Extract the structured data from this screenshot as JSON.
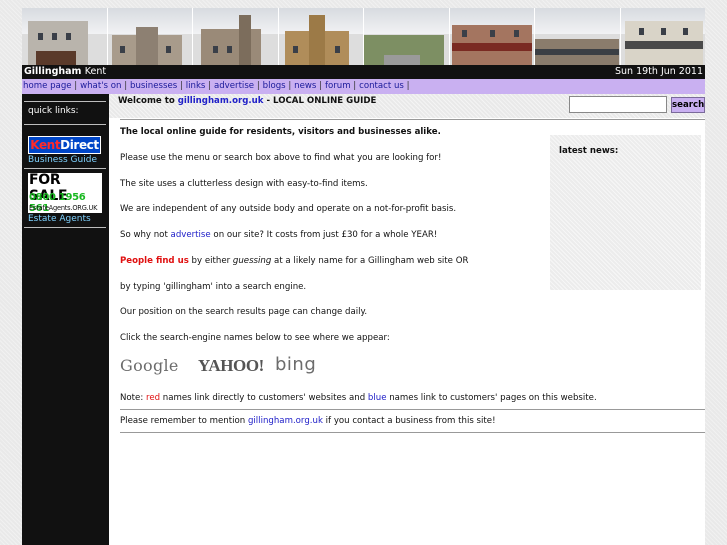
{
  "header": {
    "place": "Gillingham",
    "county": "Kent",
    "date": "Sun 19th Jun 2011"
  },
  "nav": {
    "items": [
      "home page",
      "what's on",
      "businesses",
      "links",
      "advertise",
      "blogs",
      "news",
      "forum",
      "contact us"
    ]
  },
  "sidebar": {
    "heading": "quick links:",
    "kent_logo": [
      "Kent",
      "Direct"
    ],
    "kent_link": "Business Guide",
    "sale_logo": [
      "FOR SALE",
      "0800 1956 561",
      "EstateAgents.ORG.UK"
    ],
    "sale_link": "Estate Agents"
  },
  "welcome": {
    "prefix": "Welcome to ",
    "site": "gillingham.org.uk",
    "suffix": " - LOCAL ONLINE GUIDE"
  },
  "search": {
    "button": "search",
    "value": ""
  },
  "news": {
    "heading": "latest news:"
  },
  "content": {
    "intro": "The local online guide for residents, visitors and businesses alike.",
    "menu": "Please use the menu or search box above to find what you are looking for!",
    "design": "The site uses a clutterless design with easy-to-find items.",
    "independent": "We are independent of any outside body and operate on a not-for-profit basis.",
    "advert_pre": "So why not ",
    "advert_link": "advertise",
    "advert_post": " on our site? It costs from just £30 for a whole YEAR!",
    "find_bold": "People find us",
    "find_pre": " by either ",
    "find_em": "guessing",
    "find_post": " at a likely name for a Gillingham web site OR",
    "typing": "by typing 'gillingham' into a search engine.",
    "position": "Our position on the search results page can change daily.",
    "click": "Click the search-engine names below to see where we appear:",
    "note_pre": "Note: ",
    "note_red": "red",
    "note_mid": " names link directly to customers' websites and ",
    "note_blue": "blue",
    "note_post": " names link to customers' pages on this website.",
    "remember_pre": "Please remember to mention ",
    "remember_link": "gillingham.org.uk",
    "remember_post": " if you contact a business from this site!"
  },
  "engines": [
    "Google",
    "YAHOO!",
    "bing"
  ],
  "colors": {
    "nav_bg": "#c9b0f1",
    "link_blue": "#2020c8",
    "red": "#e01010",
    "sidebar": "#111111"
  }
}
